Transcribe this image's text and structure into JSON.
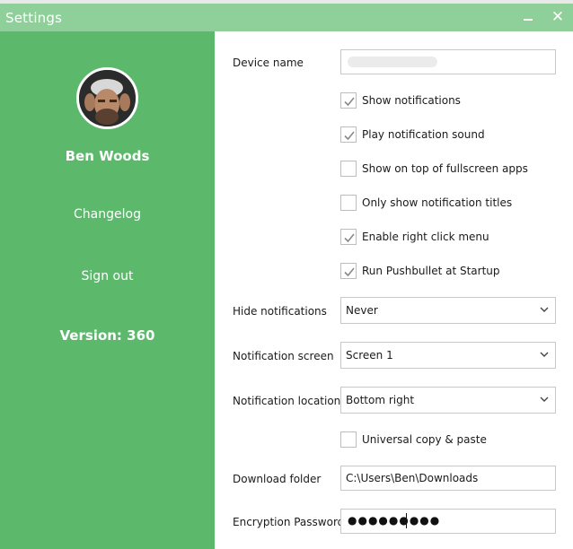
{
  "window": {
    "title": "Settings",
    "minimize_icon": "minimize-icon",
    "close_icon": "close-icon",
    "close_glyph": "✕",
    "accent_color": "#5cb96c",
    "titlebar_color": "#8fd09a"
  },
  "sidebar": {
    "user_name": "Ben Woods",
    "changelog": "Changelog",
    "sign_out": "Sign out",
    "version": "Version: 360"
  },
  "form": {
    "device_name": {
      "label": "Device name",
      "value": ""
    },
    "checkboxes": [
      {
        "label": "Show notifications",
        "checked": true
      },
      {
        "label": "Play notification sound",
        "checked": true
      },
      {
        "label": "Show on top of fullscreen apps",
        "checked": false
      },
      {
        "label": "Only show notification titles",
        "checked": false
      },
      {
        "label": "Enable right click menu",
        "checked": true
      },
      {
        "label": "Run Pushbullet at Startup",
        "checked": true
      }
    ],
    "hide_notifications": {
      "label": "Hide notifications",
      "value": "Never"
    },
    "notification_screen": {
      "label": "Notification screen",
      "value": "Screen 1"
    },
    "notification_location": {
      "label": "Notification location",
      "value": "Bottom right"
    },
    "universal_copy": {
      "label": "Universal copy & paste",
      "checked": false
    },
    "download_folder": {
      "label": "Download folder",
      "value": "C:\\Users\\Ben\\Downloads"
    },
    "encryption_password": {
      "label": "Encryption Password",
      "value": "●●●●●●●●●"
    }
  }
}
